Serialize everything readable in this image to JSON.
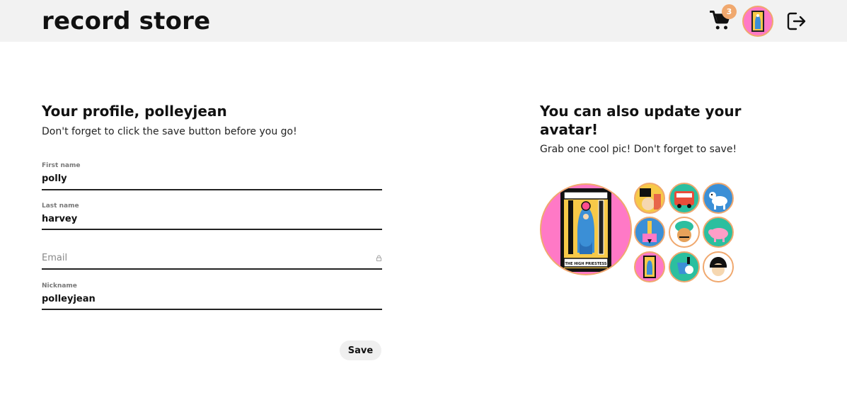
{
  "header": {
    "brand": "record store",
    "cart_count": "3",
    "icons": {
      "cart": "cart-icon",
      "logout": "logout-icon"
    }
  },
  "profile": {
    "title": "Your profile, polleyjean",
    "subtitle": "Don't forget to click the save button before you go!",
    "fields": {
      "first_name": {
        "label": "First name",
        "value": "polly"
      },
      "last_name": {
        "label": "Last name",
        "value": "harvey"
      },
      "email": {
        "placeholder": "Email",
        "value": ""
      },
      "nickname": {
        "label": "Nickname",
        "value": "polleyjean"
      }
    },
    "save_label": "Save"
  },
  "avatar_section": {
    "title": "You can also update your avatar!",
    "subtitle": "Grab one cool pic! Don't forget to save!",
    "selected": "the-high-priestess",
    "selected_card_label": "THE HIGH PRIESTESS",
    "options": [
      "book-reader",
      "red-bus",
      "dog",
      "pencil-hand",
      "turban-man",
      "pig",
      "the-high-priestess",
      "bucket-hand",
      "bowl-cut-man"
    ]
  },
  "colors": {
    "header_bg": "#f2f2f2",
    "accent": "#f0a86e",
    "avatar_pink": "#ff79c6",
    "button_bg": "#efefef"
  }
}
